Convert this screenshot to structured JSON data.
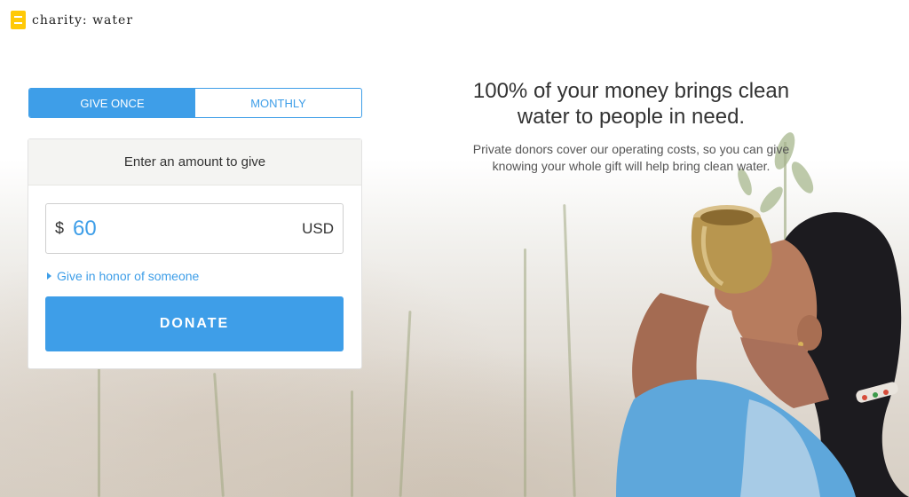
{
  "logo": {
    "text": "charity: water",
    "color": "#ffc907"
  },
  "tabs": {
    "give_once": "GIVE ONCE",
    "monthly": "MONTHLY",
    "active": "give_once"
  },
  "form": {
    "header": "Enter an amount to give",
    "currency_symbol": "$",
    "amount": "60",
    "currency_code": "USD",
    "honor_link": "Give in honor of someone",
    "donate_label": "DONATE"
  },
  "hero": {
    "headline_line1": "100% of your money brings clean",
    "headline_line2": "water to people in need.",
    "sub_line1": "Private donors cover our operating costs, so you can give",
    "sub_line2": "knowing your whole gift will help bring clean water."
  },
  "colors": {
    "accent": "#3e9ee8",
    "brand_yellow": "#ffc907"
  },
  "background": {
    "image": "girl-drinking-water-from-brass-pot-photo"
  }
}
